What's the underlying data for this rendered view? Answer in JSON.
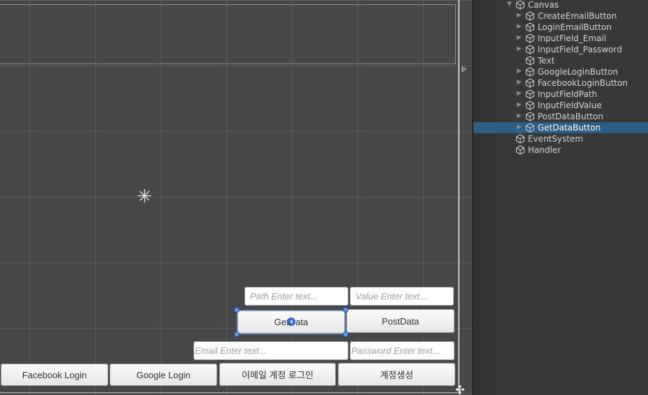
{
  "scene": {
    "buttons": {
      "get_data": "GetData",
      "post_data": "PostData",
      "facebook_login": "Facebook Login",
      "google_login": "Google Login",
      "email_login": "이메일 계정 로그인",
      "create_account": "계정생성"
    },
    "inputs": {
      "path_placeholder": "Path Enter text...",
      "value_placeholder": "Value Enter text...",
      "email_placeholder": "Email Enter text...",
      "password_placeholder": "Password Enter text..."
    },
    "selected_object": "GetDataButton"
  },
  "hierarchy": {
    "canvas": "Canvas",
    "children": [
      "CreateEmailButton",
      "LoginEmailButton",
      "InputField_Email",
      "InputField_Password",
      "Text",
      "GoogleLoginButton",
      "FacebookLoginButton",
      "InputFieldPath",
      "InputFieldValue",
      "PostDataButton",
      "GetDataButton"
    ],
    "event_system": "EventSystem",
    "handler": "Handler"
  },
  "colors": {
    "selection": "#2c5d87",
    "scene_bg": "#474747",
    "handle": "#5b9bf0"
  }
}
